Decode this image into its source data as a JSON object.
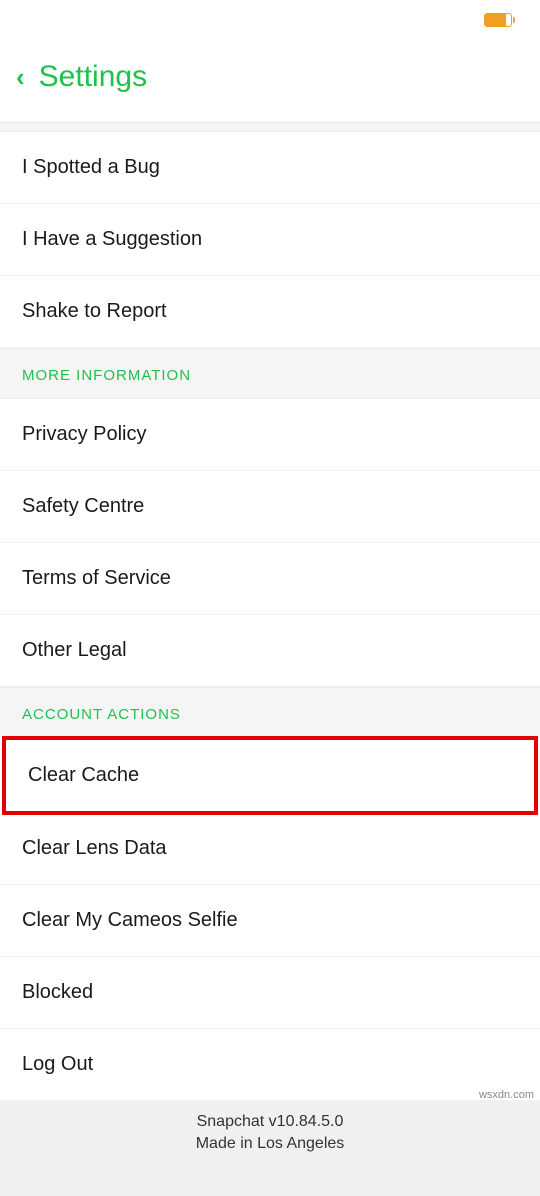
{
  "header": {
    "title": "Settings"
  },
  "sections": {
    "feedback": {
      "items": [
        "I Spotted a Bug",
        "I Have a Suggestion",
        "Shake to Report"
      ]
    },
    "more_information": {
      "header": "MORE INFORMATION",
      "items": [
        "Privacy Policy",
        "Safety Centre",
        "Terms of Service",
        "Other Legal"
      ]
    },
    "account_actions": {
      "header": "ACCOUNT ACTIONS",
      "items": [
        "Clear Cache",
        "Clear Lens Data",
        "Clear My Cameos Selfie",
        "Blocked",
        "Log Out"
      ]
    }
  },
  "footer": {
    "version": "Snapchat v10.84.5.0",
    "tagline": "Made in Los Angeles"
  },
  "watermark": "wsxdn.com"
}
